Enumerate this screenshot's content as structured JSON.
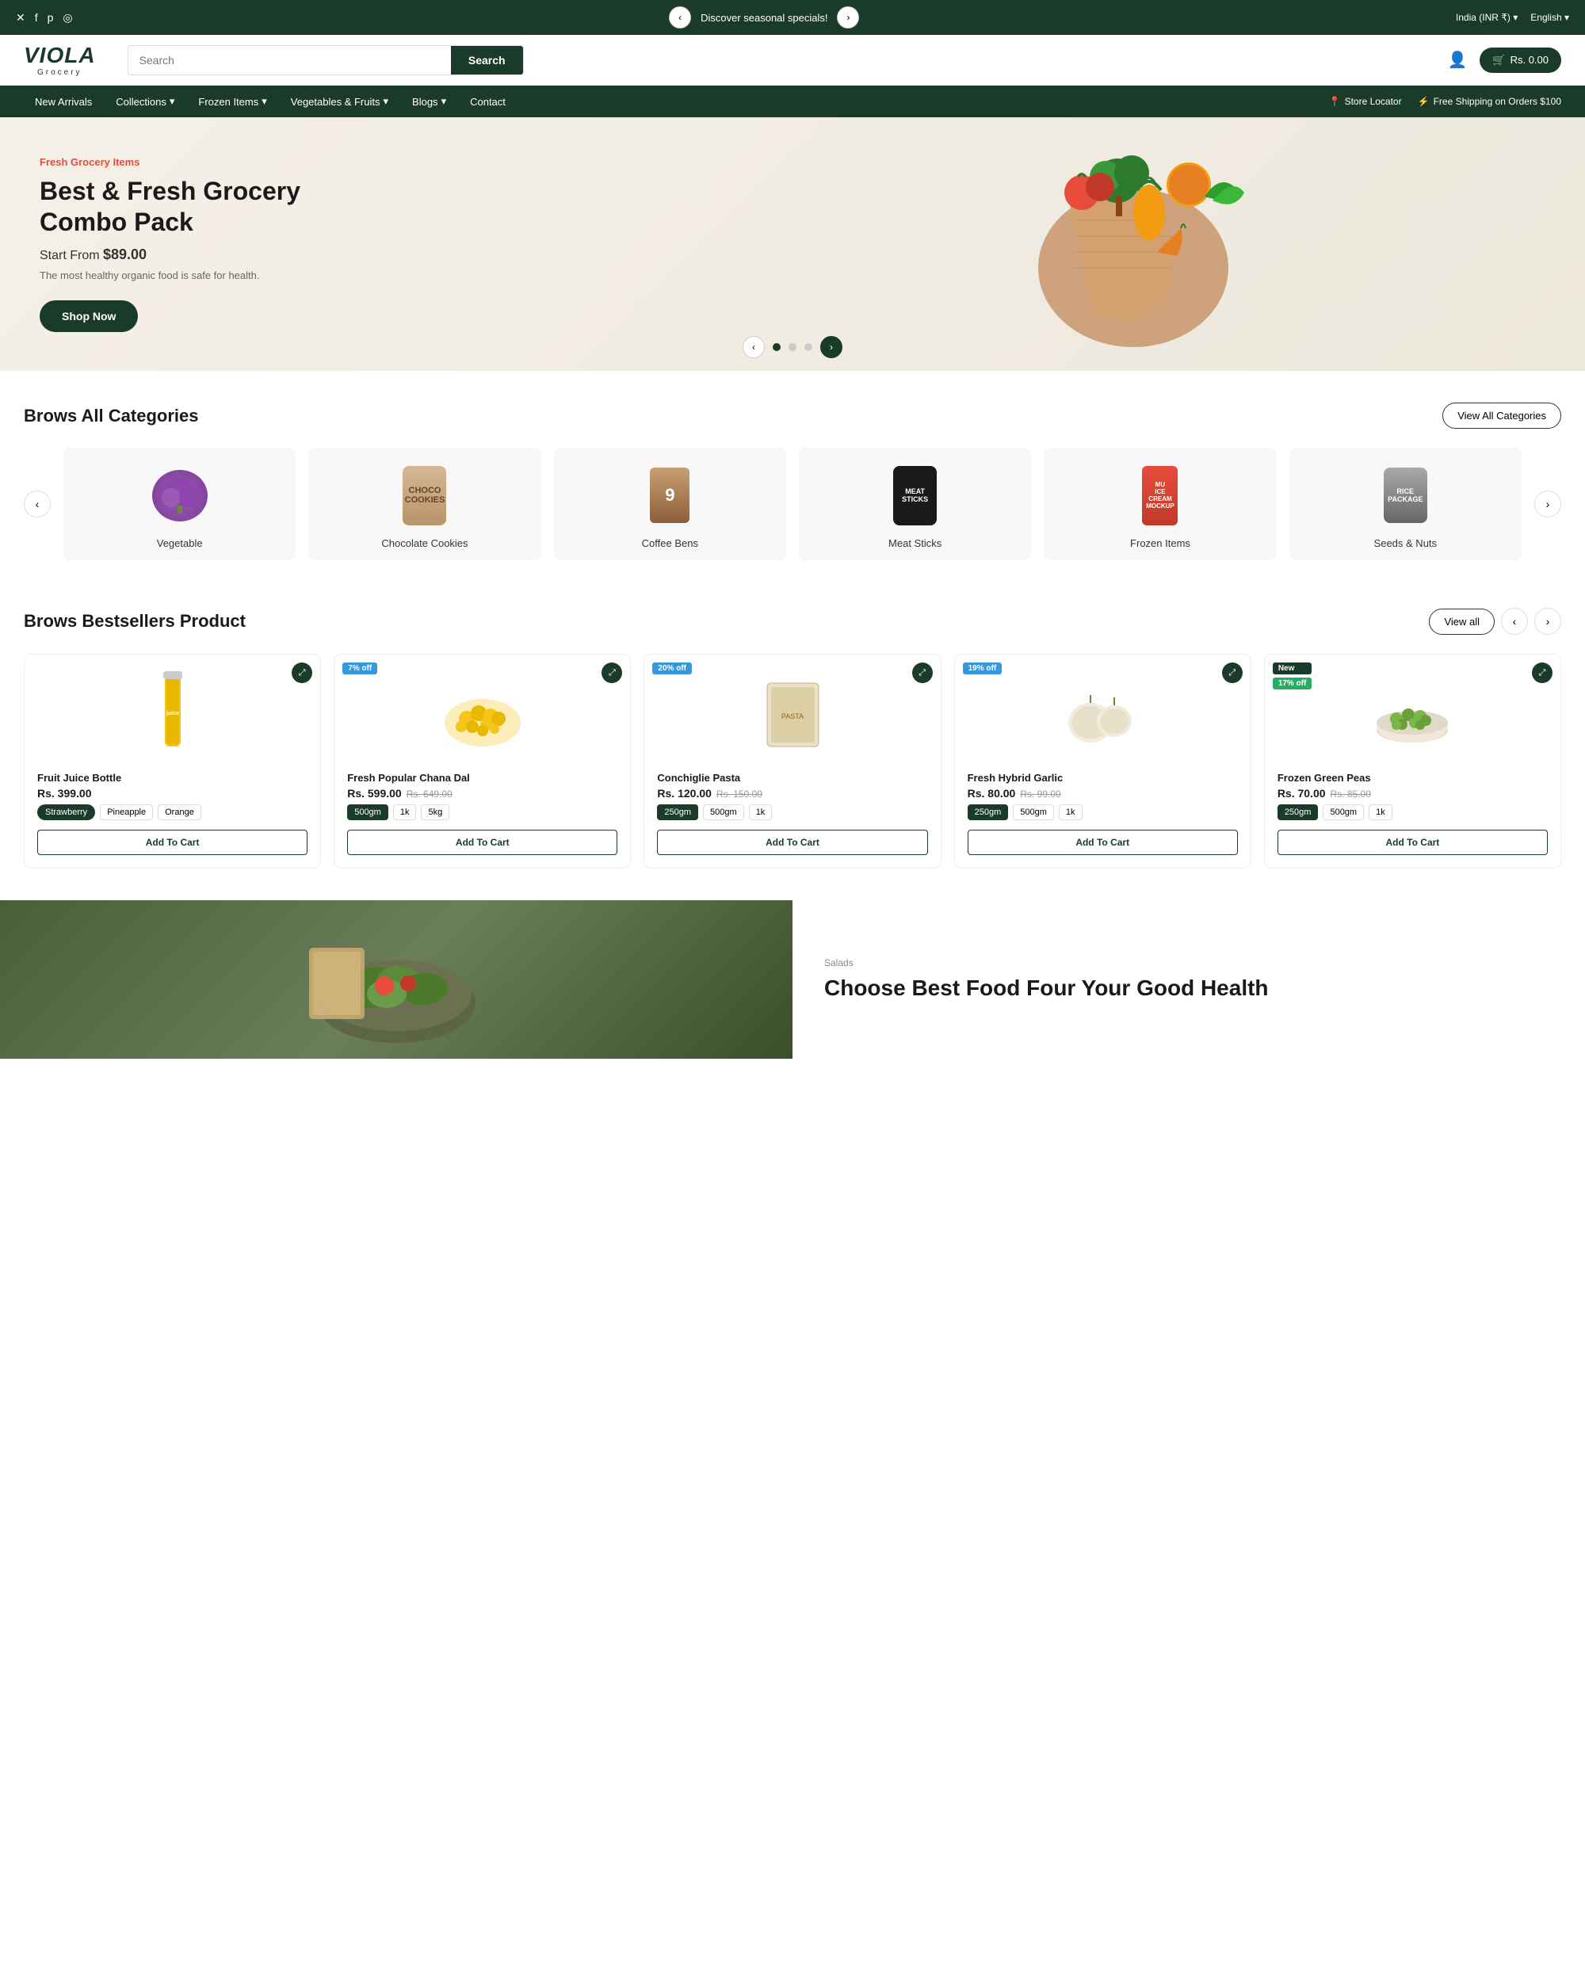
{
  "announcement": {
    "text": "Discover seasonal specials!",
    "prev_icon": "‹",
    "next_icon": "›",
    "social": [
      "✕",
      "f",
      "p",
      "◎"
    ],
    "right_items": [
      "India (INR ₹) ▾",
      "English ▾"
    ]
  },
  "header": {
    "logo_text": "VIOLA",
    "logo_sub": "Grocery",
    "search_placeholder": "Search",
    "search_btn": "Search",
    "cart_text": "Rs. 0.00"
  },
  "nav": {
    "items": [
      {
        "label": "New Arrivals",
        "has_dropdown": false
      },
      {
        "label": "Collections",
        "has_dropdown": true
      },
      {
        "label": "Frozen Items",
        "has_dropdown": true
      },
      {
        "label": "Vegetables & Fruits",
        "has_dropdown": true
      },
      {
        "label": "Blogs",
        "has_dropdown": true
      },
      {
        "label": "Contact",
        "has_dropdown": false
      }
    ],
    "right_items": [
      {
        "icon": "📍",
        "label": "Store Locator"
      },
      {
        "icon": "⚡",
        "label": "Free Shipping on Orders $100"
      }
    ]
  },
  "hero": {
    "tag": "Fresh Grocery Items",
    "title": "Best & Fresh Grocery Combo Pack",
    "price_prefix": "Start From",
    "price": "$89.00",
    "desc": "The most healthy organic food is safe for health.",
    "btn_label": "Shop Now",
    "dots": [
      true,
      false,
      false
    ]
  },
  "categories": {
    "section_title": "Brows All Categories",
    "view_all_label": "View All Categories",
    "items": [
      {
        "name": "Vegetable",
        "color": "#9b59b6",
        "shape": "round"
      },
      {
        "name": "Chocolate Cookies",
        "color": "#c8a96e",
        "shape": "rect"
      },
      {
        "name": "Coffee Bens",
        "color": "#b5885a",
        "shape": "rect"
      },
      {
        "name": "Meat Sticks",
        "color": "#2c2c2c",
        "shape": "rect"
      },
      {
        "name": "Frozen Items",
        "color": "#e74c3c",
        "shape": "rect"
      },
      {
        "name": "Seeds & Nuts",
        "color": "#888",
        "shape": "rect"
      }
    ]
  },
  "bestsellers": {
    "section_title": "Brows Bestsellers Product",
    "view_all_label": "View all",
    "products": [
      {
        "name": "Fruit Juice Bottle",
        "price": "Rs. 399.00",
        "old_price": null,
        "badges": [],
        "variants_type": "flavor",
        "variants": [
          "Strawberry",
          "Pineapple",
          "Orange"
        ],
        "active_variant": 0,
        "btn_label": "Add To Cart"
      },
      {
        "name": "Fresh Popular Chana Dal",
        "price": "Rs. 599.00",
        "old_price": "Rs. 649.00",
        "badges": [
          "7% off"
        ],
        "variants_type": "weight",
        "variants": [
          "500gm",
          "1k",
          "5kg"
        ],
        "active_variant": 0,
        "btn_label": "Add To Cart"
      },
      {
        "name": "Conchiglie Pasta",
        "price": "Rs. 120.00",
        "old_price": "Rs. 150.00",
        "badges": [
          "20% off"
        ],
        "variants_type": "weight",
        "variants": [
          "250gm",
          "500gm",
          "1k"
        ],
        "active_variant": 0,
        "btn_label": "Add To Cart"
      },
      {
        "name": "Fresh Hybrid Garlic",
        "price": "Rs. 80.00",
        "old_price": "Rs. 99.00",
        "badges": [
          "19% off"
        ],
        "variants_type": "weight",
        "variants": [
          "250gm",
          "500gm",
          "1k"
        ],
        "active_variant": 0,
        "btn_label": "Add To Cart"
      },
      {
        "name": "Frozen Green Peas",
        "price": "Rs. 70.00",
        "old_price": "Rs. 85.00",
        "badges": [
          "New",
          "17% off"
        ],
        "variants_type": "weight",
        "variants": [
          "250gm",
          "500gm",
          "1k"
        ],
        "active_variant": 0,
        "btn_label": "Add To Cart"
      }
    ]
  },
  "bottom_banner": {
    "tag": "Salads",
    "title": "Choose Best Food Four Your Good Health"
  }
}
